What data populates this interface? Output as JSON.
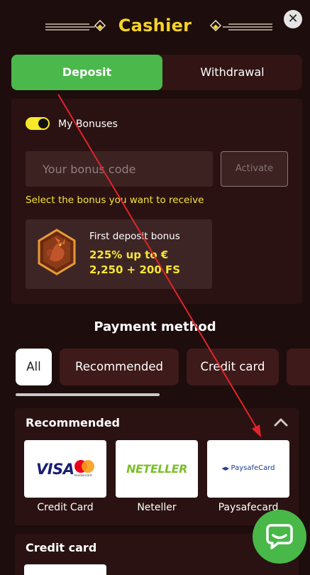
{
  "header": {
    "title": "Cashier",
    "close_glyph": "✕"
  },
  "tabs": {
    "deposit": "Deposit",
    "withdrawal": "Withdrawal"
  },
  "bonuses": {
    "toggle_label": "My Bonuses",
    "toggle_on": true,
    "code_placeholder": "Your bonus code",
    "code_value": "",
    "activate_label": "Activate",
    "hint": "Select the bonus you want to receive",
    "card": {
      "title": "First deposit bonus",
      "amount": "225% up to € 2,250 + 200 FS"
    }
  },
  "payment": {
    "title": "Payment method",
    "filters": [
      "All",
      "Recommended",
      "Credit card",
      ""
    ],
    "selected_filter": "All",
    "sections": [
      {
        "title": "Recommended",
        "methods": [
          {
            "label": "Credit Card",
            "logo_text": "VISA",
            "logo_sub": "mastercard"
          },
          {
            "label": "Neteller",
            "logo_text": "NETELLER"
          },
          {
            "label": "Paysafecard",
            "logo_text": "PaysafeCard"
          }
        ]
      },
      {
        "title": "Credit card"
      }
    ]
  },
  "colors": {
    "background": "#1d0d0c",
    "accent_yellow": "#f5d326",
    "deposit_green": "#4bb84b",
    "panel": "#2b1212",
    "annotation_arrow": "#e0242a"
  },
  "icons": [
    "close-icon",
    "dragon-bonus-icon",
    "chevron-up-icon",
    "chat-icon"
  ]
}
